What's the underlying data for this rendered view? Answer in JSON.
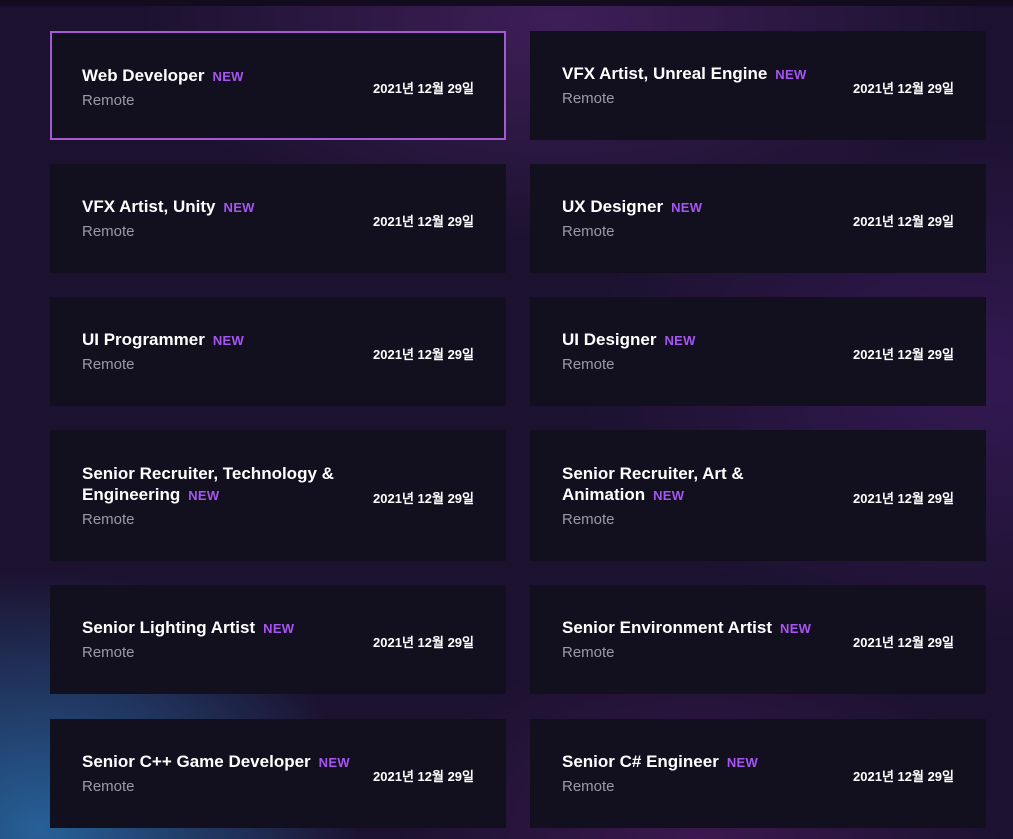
{
  "colors": {
    "accent": "#a655f0",
    "card_bg": "#12101f",
    "active_border": "#a45ad0"
  },
  "jobs": [
    {
      "title": "Web Developer",
      "badge": "NEW",
      "location": "Remote",
      "date": "2021년 12월 29일"
    },
    {
      "title": "VFX Artist, Unreal Engine",
      "badge": "NEW",
      "location": "Remote",
      "date": "2021년 12월 29일"
    },
    {
      "title": "VFX Artist, Unity",
      "badge": "NEW",
      "location": "Remote",
      "date": "2021년 12월 29일"
    },
    {
      "title": "UX Designer",
      "badge": "NEW",
      "location": "Remote",
      "date": "2021년 12월 29일"
    },
    {
      "title": "UI Programmer",
      "badge": "NEW",
      "location": "Remote",
      "date": "2021년 12월 29일"
    },
    {
      "title": "UI Designer",
      "badge": "NEW",
      "location": "Remote",
      "date": "2021년 12월 29일"
    },
    {
      "title": "Senior Recruiter, Technology & Engineering",
      "badge": "NEW",
      "location": "Remote",
      "date": "2021년 12월 29일"
    },
    {
      "title": "Senior Recruiter, Art & Animation",
      "badge": "NEW",
      "location": "Remote",
      "date": "2021년 12월 29일"
    },
    {
      "title": "Senior Lighting Artist",
      "badge": "NEW",
      "location": "Remote",
      "date": "2021년 12월 29일"
    },
    {
      "title": "Senior Environment Artist",
      "badge": "NEW",
      "location": "Remote",
      "date": "2021년 12월 29일"
    },
    {
      "title": "Senior C++ Game Developer",
      "badge": "NEW",
      "location": "Remote",
      "date": "2021년 12월 29일"
    },
    {
      "title": "Senior C# Engineer",
      "badge": "NEW",
      "location": "Remote",
      "date": "2021년 12월 29일"
    }
  ]
}
